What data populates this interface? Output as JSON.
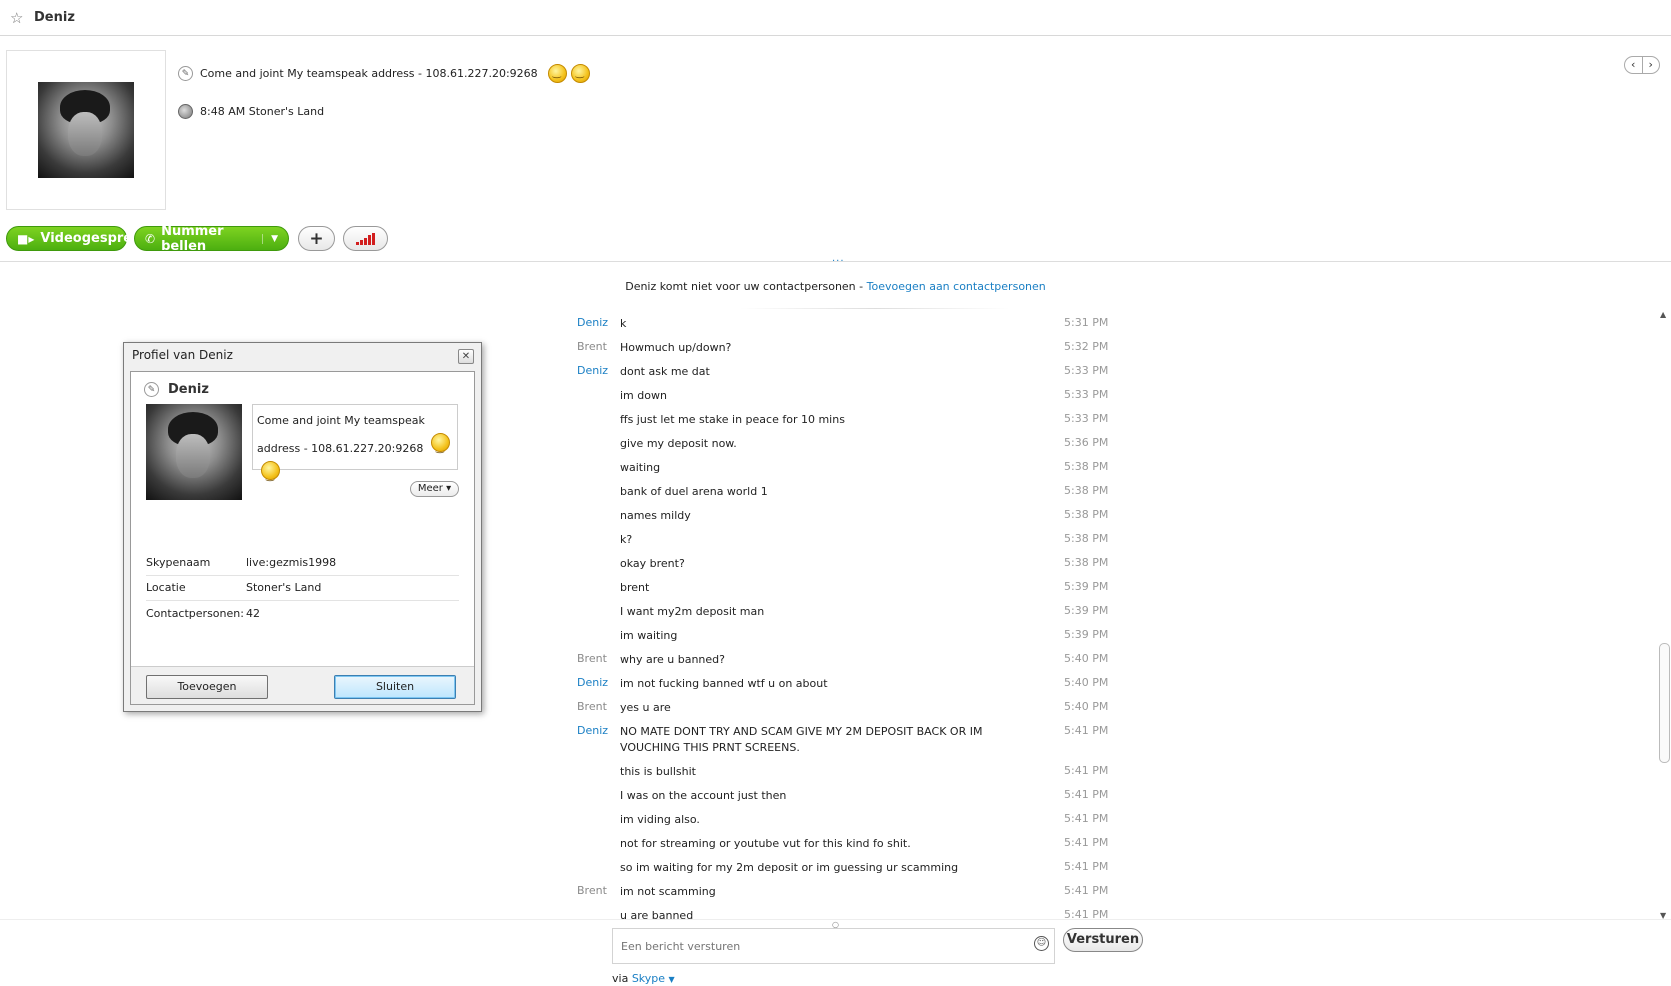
{
  "window": {
    "title": "Deniz"
  },
  "header": {
    "mood": "Come and joint My teamspeak address - 108.61.227.20:9268",
    "location": "8:48 AM Stoner's Land",
    "nav_prev": "‹",
    "nav_next": "›"
  },
  "actions": {
    "video_label": "Videogesprek",
    "call_label": "Nummer bellen",
    "add_label": "+",
    "more_dots": "..."
  },
  "notice": {
    "text": "Deniz komt niet voor uw contactpersonen - ",
    "link": "Toevoegen aan contactpersonen"
  },
  "messages": [
    {
      "sender": "Deniz",
      "text": "k",
      "time": "5:31 PM"
    },
    {
      "sender": "Brent",
      "text": "Howmuch up/down?",
      "time": "5:32 PM"
    },
    {
      "sender": "Deniz",
      "text": "dont ask me dat",
      "time": "5:33 PM"
    },
    {
      "sender": "",
      "text": "im down",
      "time": "5:33 PM"
    },
    {
      "sender": "",
      "text": "ffs just let me stake in peace for 10 mins",
      "time": "5:33 PM"
    },
    {
      "sender": "",
      "text": "give my deposit now.",
      "time": "5:36 PM"
    },
    {
      "sender": "",
      "text": "waiting",
      "time": "5:38 PM"
    },
    {
      "sender": "",
      "text": "bank of duel arena world 1",
      "time": "5:38 PM"
    },
    {
      "sender": "",
      "text": "names mildy",
      "time": "5:38 PM"
    },
    {
      "sender": "",
      "text": "k?",
      "time": "5:38 PM"
    },
    {
      "sender": "",
      "text": "okay brent?",
      "time": "5:38 PM"
    },
    {
      "sender": "",
      "text": "brent",
      "time": "5:39 PM"
    },
    {
      "sender": "",
      "text": "I want my2m deposit man",
      "time": "5:39 PM"
    },
    {
      "sender": "",
      "text": "im waiting",
      "time": "5:39 PM"
    },
    {
      "sender": "Brent",
      "text": "why are u banned?",
      "time": "5:40 PM"
    },
    {
      "sender": "Deniz",
      "text": "im not fucking banned wtf u on about",
      "time": "5:40 PM"
    },
    {
      "sender": "Brent",
      "text": "yes u are",
      "time": "5:40 PM"
    },
    {
      "sender": "Deniz",
      "text": "NO MATE DONT TRY AND SCAM GIVE MY 2M DEPOSIT BACK OR IM VOUCHING THIS PRNT SCREENS.",
      "time": "5:41 PM"
    },
    {
      "sender": "",
      "text": "this is bullshit",
      "time": "5:41 PM"
    },
    {
      "sender": "",
      "text": "I was on the account just then",
      "time": "5:41 PM"
    },
    {
      "sender": "",
      "text": "im viding also.",
      "time": "5:41 PM"
    },
    {
      "sender": "",
      "text": "not for streaming or youtube vut for this kind fo shit.",
      "time": "5:41 PM"
    },
    {
      "sender": "",
      "text": "so im waiting for my 2m deposit or im guessing ur scamming",
      "time": "5:41 PM"
    },
    {
      "sender": "Brent",
      "text": "im not scamming",
      "time": "5:41 PM"
    },
    {
      "sender": "",
      "text": "u are banned",
      "time": "5:41 PM"
    }
  ],
  "composer": {
    "placeholder": "Een bericht versturen",
    "send_label": "Versturen",
    "via_text": "via ",
    "via_link": "Skype"
  },
  "profile_dialog": {
    "title": "Profiel van Deniz",
    "name": "Deniz",
    "mood": "Come and joint My teamspeak address - 108.61.227.20:9268",
    "more_label": "Meer",
    "fields": [
      {
        "label": "Skypenaam",
        "value": "live:gezmis1998"
      },
      {
        "label": "Locatie",
        "value": "Stoner's Land"
      },
      {
        "label": "Contactpersonen:",
        "value": "42"
      }
    ],
    "add_label": "Toevoegen",
    "close_label": "Sluiten"
  },
  "colors": {
    "accent_blue": "#1a7fc4",
    "call_green": "#5cb815",
    "signal_red": "#d21e1e"
  }
}
